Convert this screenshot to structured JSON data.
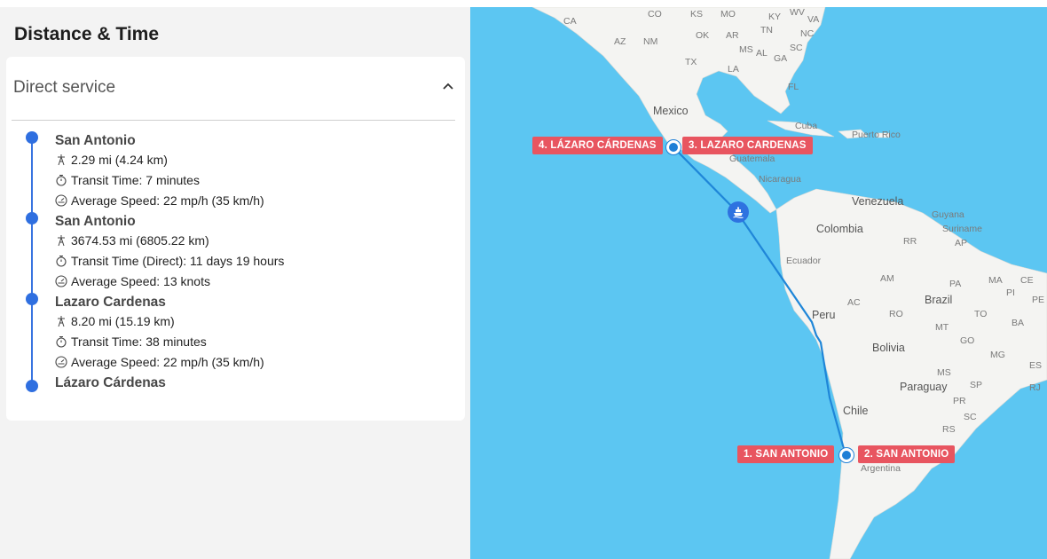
{
  "panel": {
    "title": "Distance & Time",
    "accordion_title": "Direct service"
  },
  "timeline": {
    "stops": [
      {
        "name": "San Antonio"
      },
      {
        "name": "San Antonio"
      },
      {
        "name": "Lazaro Cardenas"
      },
      {
        "name": "Lázaro Cárdenas"
      }
    ],
    "legs": [
      {
        "distance": "2.29 mi (4.24 km)",
        "transit": "Transit Time:  7 minutes",
        "speed": "Average Speed:  22 mp/h (35 km/h)"
      },
      {
        "distance": "3674.53 mi (6805.22 km)",
        "transit": "Transit Time (Direct):  11 days 19 hours",
        "speed": "Average Speed:  13 knots"
      },
      {
        "distance": "8.20 mi (15.19 km)",
        "transit": "Transit Time:  38 minutes",
        "speed": "Average Speed:  22 mp/h (35 km/h)"
      }
    ]
  },
  "map": {
    "port_labels": [
      "1. SAN ANTONIO",
      "2. SAN ANTONIO",
      "3. LAZARO CARDENAS",
      "4. LÁZARO CÁRDENAS"
    ],
    "countries": {
      "mexico": "Mexico",
      "cuba": "Cuba",
      "puerto_rico": "Puerto Rico",
      "guatemala": "Guatemala",
      "nicaragua": "Nicaragua",
      "venezuela": "Venezuela",
      "guyana": "Guyana",
      "suriname": "Suriname",
      "colombia": "Colombia",
      "ecuador": "Ecuador",
      "peru": "Peru",
      "brazil": "Brazil",
      "bolivia": "Bolivia",
      "paraguay": "Paraguay",
      "chile": "Chile",
      "argentina": "Argentina"
    },
    "states": {
      "ca": "CA",
      "co": "CO",
      "ks": "KS",
      "mo": "MO",
      "ky": "KY",
      "wv": "WV",
      "va": "VA",
      "az": "AZ",
      "nm": "NM",
      "ok": "OK",
      "ar": "AR",
      "tn": "TN",
      "nc": "NC",
      "ms": "MS",
      "al": "AL",
      "ga": "GA",
      "sc": "SC",
      "tx": "TX",
      "la": "LA",
      "fl": "FL",
      "rr": "RR",
      "ap": "AP",
      "am": "AM",
      "pa": "PA",
      "ma": "MA",
      "ce": "CE",
      "pi": "PI",
      "pe": "PE",
      "ac": "AC",
      "ro": "RO",
      "to": "TO",
      "ba": "BA",
      "mt": "MT",
      "go": "GO",
      "mg": "MG",
      "es": "ES",
      "ms2": "MS",
      "sp": "SP",
      "rj": "RJ",
      "pr": "PR",
      "sc2": "SC",
      "rs": "RS"
    },
    "colors": {
      "water": "#5cc6f2",
      "land": "#f4f4f2",
      "route": "#1f86d8",
      "port_label": "#e85560",
      "timeline": "#2f6fe0"
    },
    "icons": {
      "ship": "ship-icon"
    }
  }
}
